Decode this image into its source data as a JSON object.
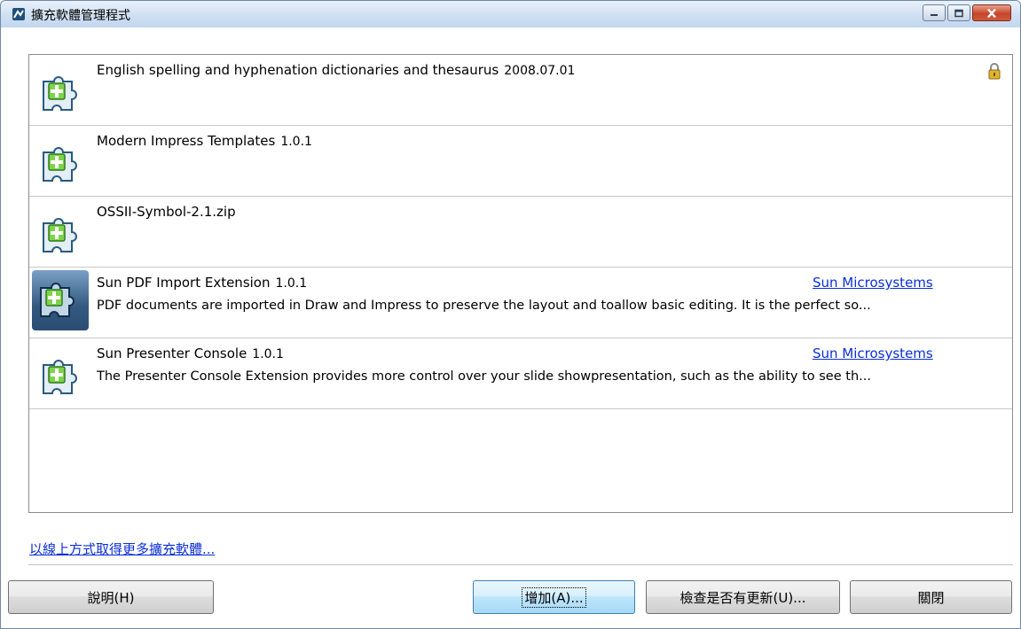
{
  "window": {
    "title": "擴充軟體管理程式"
  },
  "extensions": [
    {
      "name": "English spelling and hyphenation dictionaries and thesaurus",
      "version": "2008.07.01",
      "description": "",
      "publisher": "",
      "locked": true,
      "selected": false
    },
    {
      "name": "Modern Impress Templates",
      "version": "1.0.1",
      "description": "",
      "publisher": "",
      "locked": false,
      "selected": false
    },
    {
      "name": "OSSII-Symbol-2.1.zip",
      "version": "",
      "description": "",
      "publisher": "",
      "locked": false,
      "selected": false
    },
    {
      "name": "Sun PDF Import Extension",
      "version": "1.0.1",
      "description": "PDF documents are imported in Draw and Impress to preserve the layout and toallow basic editing. It is the perfect so...",
      "publisher": "Sun Microsystems",
      "locked": false,
      "selected": true
    },
    {
      "name": "Sun Presenter Console",
      "version": "1.0.1",
      "description": "The Presenter Console Extension provides more control over your slide showpresentation, such as the ability to see th...",
      "publisher": "Sun Microsystems",
      "locked": false,
      "selected": false
    }
  ],
  "links": {
    "get_more_online": "以線上方式取得更多擴充軟體..."
  },
  "buttons": {
    "help": "說明(H)",
    "add": "增加(A)...",
    "check_updates": "檢查是否有更新(U)...",
    "close": "關閉"
  },
  "colors": {
    "link": "#0b2fd6",
    "window_frame": "#c9dcef",
    "selected_icon_bg": "#33597f"
  }
}
